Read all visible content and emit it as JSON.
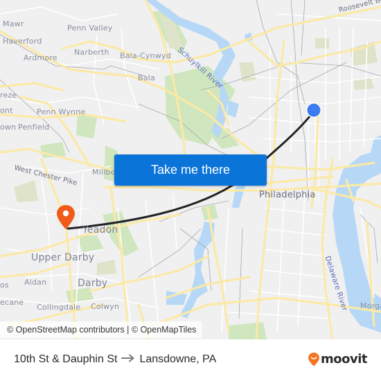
{
  "map": {
    "labels": [
      {
        "text": "Mawr",
        "cls": "",
        "name": "place-label-bryn-mawr"
      },
      {
        "text": "Penn Valley",
        "cls": "",
        "name": "place-label-penn-valley"
      },
      {
        "text": "Haverford",
        "cls": "",
        "name": "place-label-haverford"
      },
      {
        "text": "Narberth",
        "cls": "",
        "name": "place-label-narberth"
      },
      {
        "text": "Bala-Cynwyd",
        "cls": "",
        "name": "place-label-bala-cynwyd"
      },
      {
        "text": "Ardmore",
        "cls": "",
        "name": "place-label-ardmore"
      },
      {
        "text": "Bala",
        "cls": "",
        "name": "place-label-bala"
      },
      {
        "text": "reze",
        "cls": "",
        "name": "place-label-wynnewood"
      },
      {
        "text": "ont",
        "cls": "",
        "name": "place-label-belmont"
      },
      {
        "text": "Penn Wynne",
        "cls": "",
        "name": "place-label-penn-wynne"
      },
      {
        "text": "own",
        "cls": "",
        "name": "place-label-town"
      },
      {
        "text": "Penfield",
        "cls": "",
        "name": "place-label-penfield"
      },
      {
        "text": "West Chester Pike",
        "cls": "road",
        "name": "road-label-west-chester-pike"
      },
      {
        "text": "Millbo",
        "cls": "",
        "name": "place-label-millbourne"
      },
      {
        "text": "Yeadon",
        "cls": "big",
        "name": "place-label-yeadon"
      },
      {
        "text": "Upper Darby",
        "cls": "big",
        "name": "place-label-upper-darby"
      },
      {
        "text": "Aldan",
        "cls": "",
        "name": "place-label-aldan"
      },
      {
        "text": "os",
        "cls": "",
        "name": "place-label-clifton"
      },
      {
        "text": "Darby",
        "cls": "big",
        "name": "place-label-darby"
      },
      {
        "text": "ecane",
        "cls": "",
        "name": "place-label-glenolden"
      },
      {
        "text": "Collingdale",
        "cls": "",
        "name": "place-label-collingdale"
      },
      {
        "text": "Colwyn",
        "cls": "",
        "name": "place-label-colwyn"
      },
      {
        "text": "Philadelphia",
        "cls": "city",
        "name": "place-label-philadelphia"
      },
      {
        "text": "Roosevelt Bo",
        "cls": "road",
        "name": "road-label-roosevelt-blvd"
      },
      {
        "text": "Schuylkill River",
        "cls": "water",
        "name": "water-label-schuylkill-river"
      },
      {
        "text": "Delaware River",
        "cls": "water",
        "name": "water-label-delaware-river"
      },
      {
        "text": "Morga",
        "cls": "",
        "name": "place-label-morgan"
      }
    ],
    "origin_marker": {
      "label": "10th St & Dauphin St",
      "color": "#3b7cf0"
    },
    "destination_marker": {
      "label": "Lansdowne, PA",
      "color": "#f05a1a"
    },
    "route_color": "#222222"
  },
  "cta": {
    "label": "Take me there",
    "color": "#0a74d9"
  },
  "attribution": "© OpenStreetMap contributors | © OpenMapTiles",
  "footer": {
    "origin": "10th St & Dauphin St",
    "arrow": "⟶",
    "destination": "Lansdowne, PA",
    "brand": "moovit",
    "brand_color": "#f47521"
  }
}
